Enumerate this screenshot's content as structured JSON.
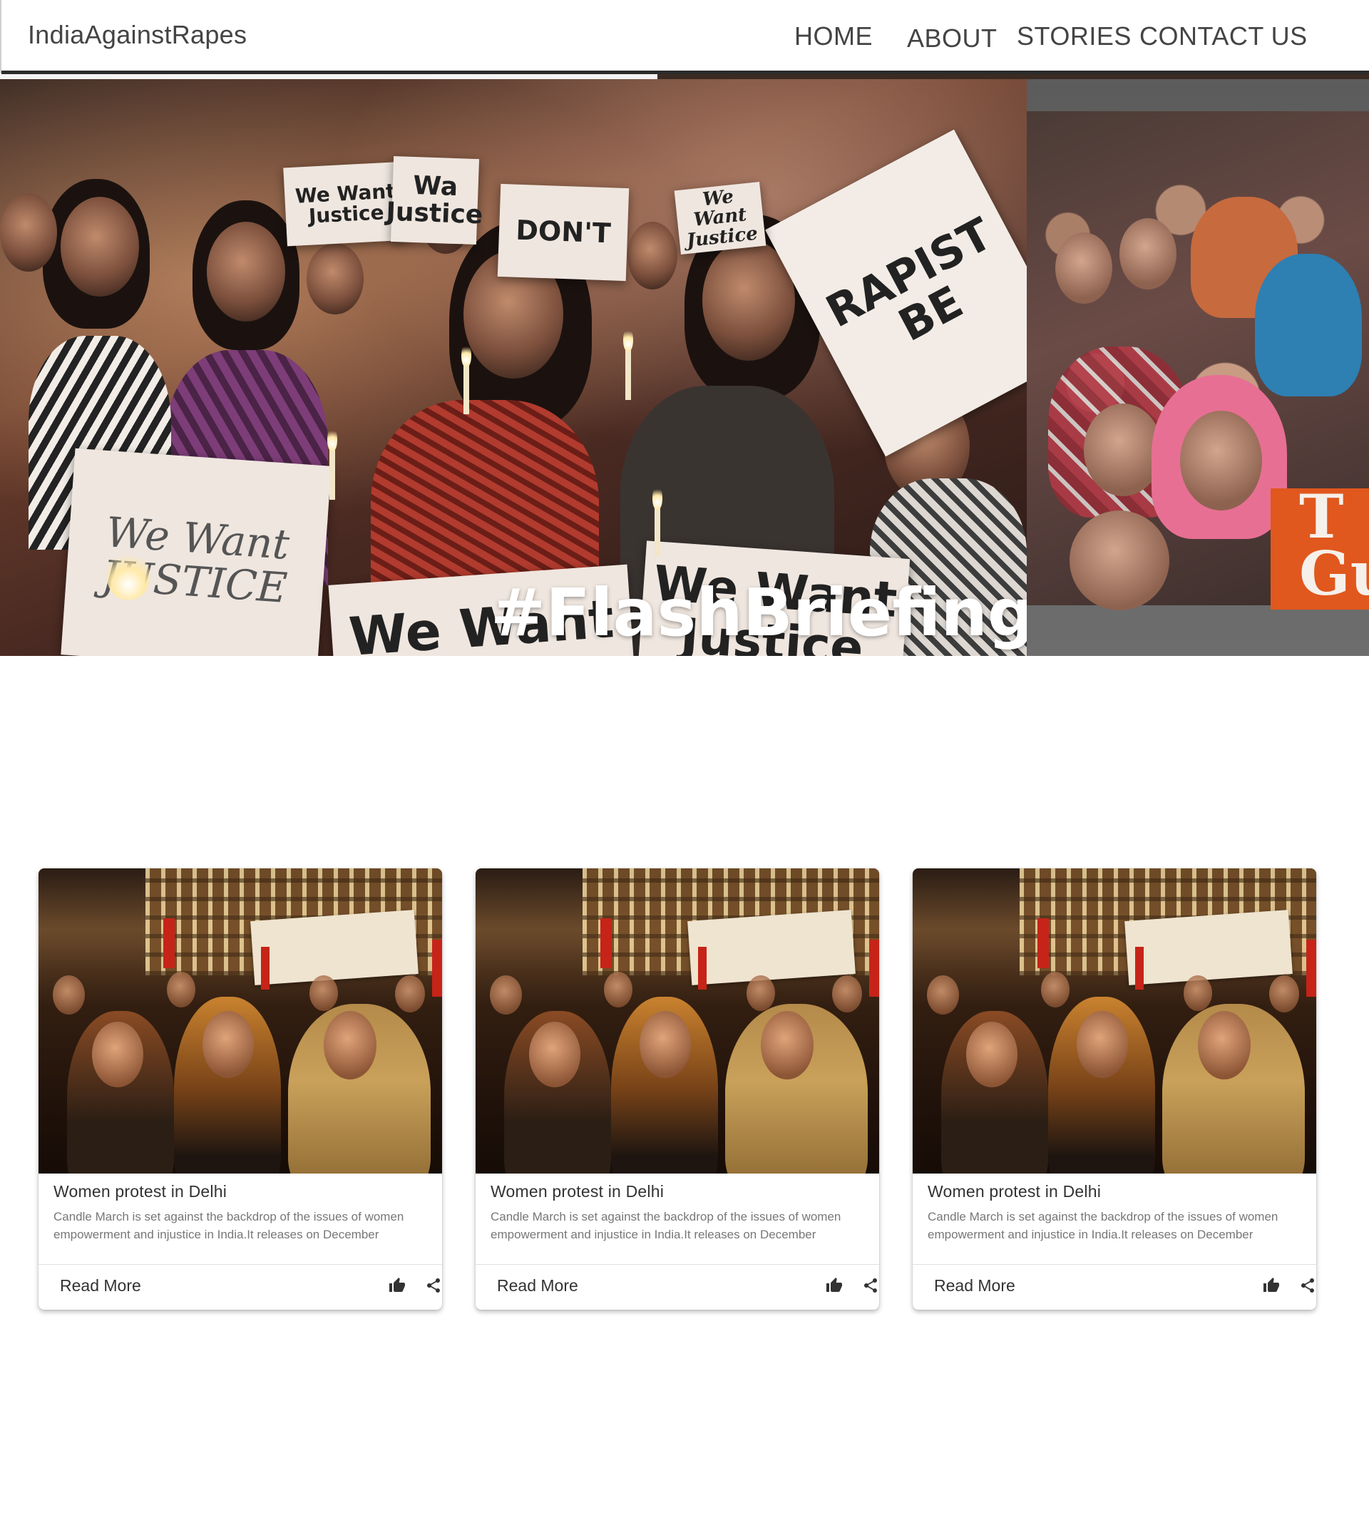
{
  "header": {
    "brand": "IndiaAgainstRapes",
    "nav": [
      {
        "label": "HOME"
      },
      {
        "label": "ABOUT"
      },
      {
        "label": "STORIES"
      },
      {
        "label": "CONTACT US"
      }
    ]
  },
  "hero": {
    "progress": 0.48,
    "main_slide": {
      "hashtag": "#FlashBriefings",
      "signs": [
        "We Want Justice",
        "We Want Justice",
        "RAPIST BE",
        "We Want JUSTICE",
        "We Want Justice",
        "We Want Justice",
        "Wa Justice",
        "DON'T"
      ]
    },
    "next_slide": {
      "logo_text": "T Gu"
    }
  },
  "cards": [
    {
      "title": "Women protest in Delhi",
      "description": "Candle March is set against the backdrop of the issues of women empowerment and injustice in India.It releases on December",
      "action": "Read More",
      "like_icon": "thumb-up-icon",
      "share_icon": "share-icon"
    },
    {
      "title": "Women protest in Delhi",
      "description": "Candle March is set against the backdrop of the issues of women empowerment and injustice in India.It releases on December",
      "action": "Read More",
      "like_icon": "thumb-up-icon",
      "share_icon": "share-icon"
    },
    {
      "title": "Women protest in Delhi",
      "description": "Candle March is set against the backdrop of the issues of women empowerment and injustice in India.It releases on December",
      "action": "Read More",
      "like_icon": "thumb-up-icon",
      "share_icon": "share-icon"
    }
  ],
  "colors": {
    "text_primary": "#333333",
    "text_secondary": "#777777",
    "guardian_orange": "#e0581d"
  }
}
